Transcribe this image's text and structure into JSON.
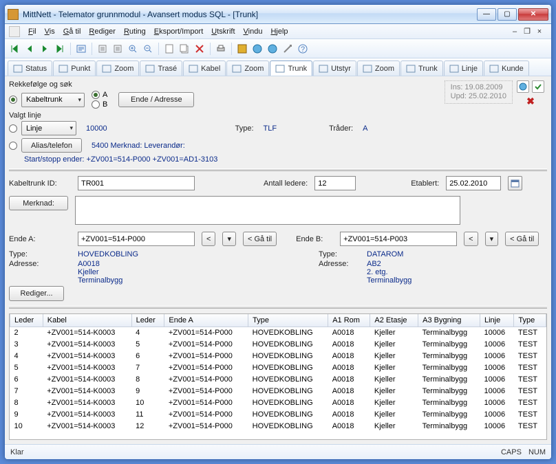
{
  "title": "MittNett - Telemator grunnmodul - Avansert modus SQL - [Trunk]",
  "menu": [
    "Fil",
    "Vis",
    "Gå til",
    "Rediger",
    "Ruting",
    "Eksport/Import",
    "Utskrift",
    "Vindu",
    "Hjelp"
  ],
  "tabs": [
    {
      "label": "Status"
    },
    {
      "label": "Punkt"
    },
    {
      "label": "Zoom"
    },
    {
      "label": "Trasé"
    },
    {
      "label": "Kabel"
    },
    {
      "label": "Zoom"
    },
    {
      "label": "Trunk",
      "active": true
    },
    {
      "label": "Utstyr"
    },
    {
      "label": "Zoom"
    },
    {
      "label": "Trunk"
    },
    {
      "label": "Linje"
    },
    {
      "label": "Kunde"
    }
  ],
  "top_panel": {
    "order_label": "Rekkefølge og søk",
    "order_combo": "Kabeltrunk",
    "opt_a": "A",
    "opt_b": "B",
    "ende_btn": "Ende / Adresse",
    "valgt_linje": "Valgt linje",
    "linje_combo": "Linje",
    "linje_val": "10000",
    "type_lbl": "Type:",
    "type_val": "TLF",
    "trader_lbl": "Tråder:",
    "trader_val": "A",
    "alias_btn": "Alias/telefon",
    "alias_val": "5400 Merknad: Leverandør:",
    "startstopp": "Start/stopp ender: +ZV001=514-P000   +ZV001=AD1-3103",
    "ins": "Ins: 19.08.2009",
    "upd": "Upd: 25.02.2010"
  },
  "mid": {
    "id_lbl": "Kabeltrunk ID:",
    "id_val": "TR001",
    "antall_lbl": "Antall ledere:",
    "antall_val": "12",
    "etab_lbl": "Etablert:",
    "etab_val": "25.02.2010",
    "merk_btn": "Merknad:",
    "merk_val": "",
    "endea_lbl": "Ende A:",
    "endea_val": "+ZV001=514-P000",
    "endeb_lbl": "Ende B:",
    "endeb_val": "+ZV001=514-P003",
    "gatil": "< Gå til",
    "typea_lbl": "Type:",
    "typea_val": "HOVEDKOBLING",
    "adra_lbl": "Adresse:",
    "adra_1": "A0018",
    "adra_2": "Kjeller",
    "adra_3": "Terminalbygg",
    "typeb_lbl": "Type:",
    "typeb_val": "DATAROM",
    "adrb_lbl": "Adresse:",
    "adrb_1": "AB2",
    "adrb_2": "2. etg.",
    "adrb_3": "Terminalbygg",
    "rediger": "Rediger..."
  },
  "table": {
    "headers": [
      "Leder",
      "Kabel",
      "Leder",
      "Ende A",
      "Type",
      "A1 Rom",
      "A2 Etasje",
      "A3 Bygning",
      "Linje",
      "Type"
    ],
    "rows": [
      [
        "2",
        "+ZV001=514-K0003",
        "4",
        "+ZV001=514-P000",
        "HOVEDKOBLING",
        "A0018",
        "Kjeller",
        "Terminalbygg",
        "10006",
        "TEST"
      ],
      [
        "3",
        "+ZV001=514-K0003",
        "5",
        "+ZV001=514-P000",
        "HOVEDKOBLING",
        "A0018",
        "Kjeller",
        "Terminalbygg",
        "10006",
        "TEST"
      ],
      [
        "4",
        "+ZV001=514-K0003",
        "6",
        "+ZV001=514-P000",
        "HOVEDKOBLING",
        "A0018",
        "Kjeller",
        "Terminalbygg",
        "10006",
        "TEST"
      ],
      [
        "5",
        "+ZV001=514-K0003",
        "7",
        "+ZV001=514-P000",
        "HOVEDKOBLING",
        "A0018",
        "Kjeller",
        "Terminalbygg",
        "10006",
        "TEST"
      ],
      [
        "6",
        "+ZV001=514-K0003",
        "8",
        "+ZV001=514-P000",
        "HOVEDKOBLING",
        "A0018",
        "Kjeller",
        "Terminalbygg",
        "10006",
        "TEST"
      ],
      [
        "7",
        "+ZV001=514-K0003",
        "9",
        "+ZV001=514-P000",
        "HOVEDKOBLING",
        "A0018",
        "Kjeller",
        "Terminalbygg",
        "10006",
        "TEST"
      ],
      [
        "8",
        "+ZV001=514-K0003",
        "10",
        "+ZV001=514-P000",
        "HOVEDKOBLING",
        "A0018",
        "Kjeller",
        "Terminalbygg",
        "10006",
        "TEST"
      ],
      [
        "9",
        "+ZV001=514-K0003",
        "11",
        "+ZV001=514-P000",
        "HOVEDKOBLING",
        "A0018",
        "Kjeller",
        "Terminalbygg",
        "10006",
        "TEST"
      ],
      [
        "10",
        "+ZV001=514-K0003",
        "12",
        "+ZV001=514-P000",
        "HOVEDKOBLING",
        "A0018",
        "Kjeller",
        "Terminalbygg",
        "10006",
        "TEST"
      ]
    ]
  },
  "status": {
    "left": "Klar",
    "caps": "CAPS",
    "num": "NUM"
  }
}
